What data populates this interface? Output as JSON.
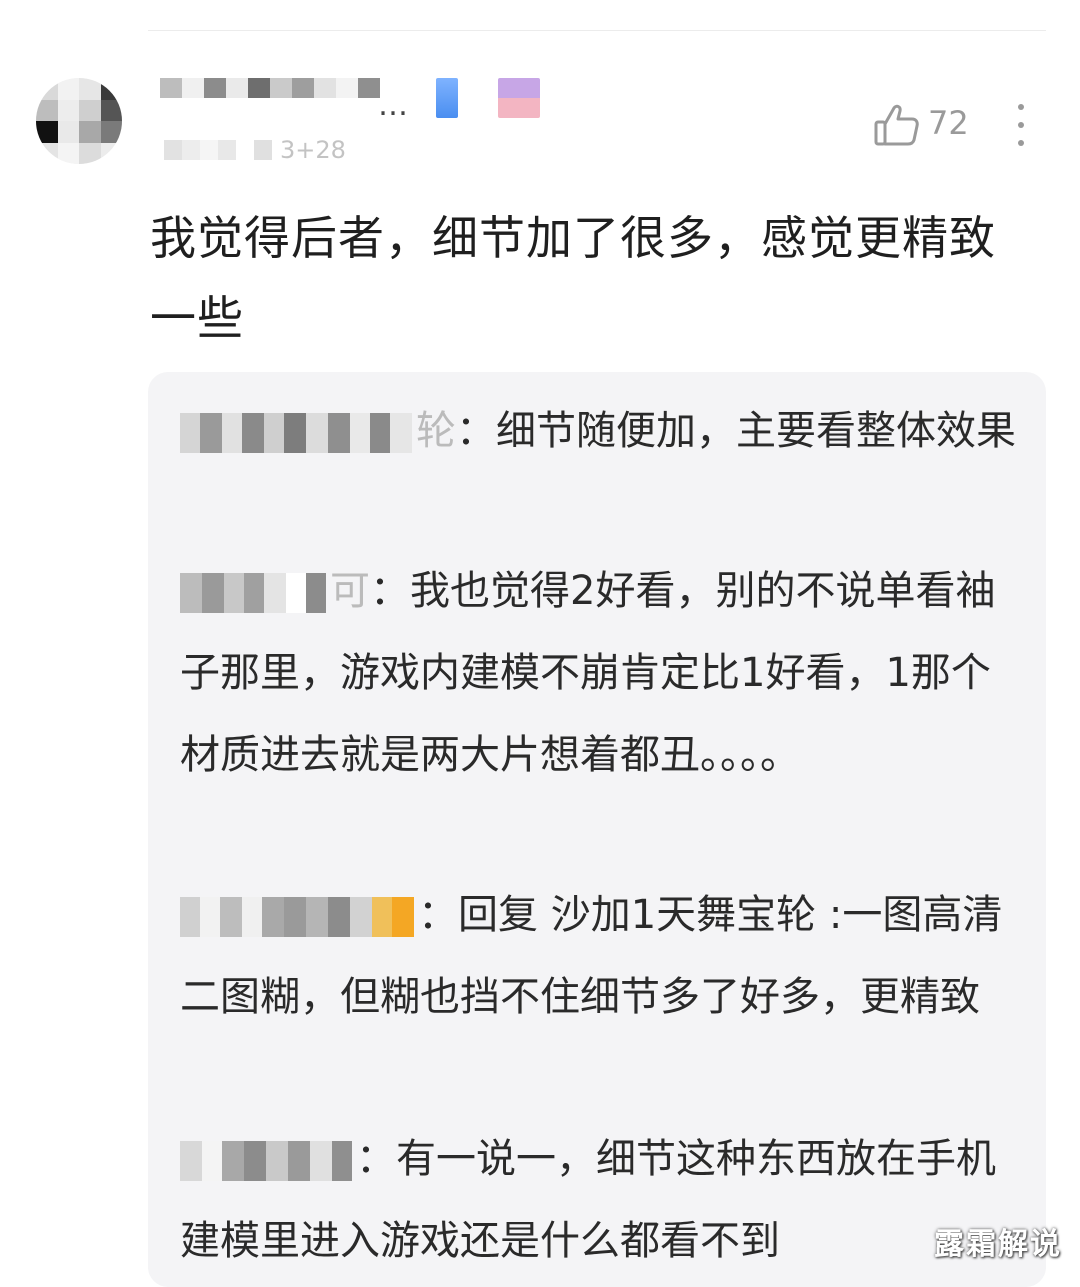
{
  "comment": {
    "like_count": "72",
    "meta_partial": "3+28",
    "username_partial": "…",
    "text": "我觉得后者，细节加了很多，感觉更精致一些"
  },
  "replies": [
    {
      "name_tail": "轮",
      "text": "：细节随便加，主要看整体效果"
    },
    {
      "name_tail": "可",
      "text": "：我也觉得2好看，别的不说单看袖子那里，游戏内建模不崩肯定比1好看，1那个材质进去就是两大片想着都丑。。。。"
    },
    {
      "name_tail": "",
      "text": "：回复 沙加1天舞宝轮 :一图高清二图糊，但糊也挡不住细节多了好多，更精致"
    },
    {
      "name_tail": "",
      "text": "：有一说一，细节这种东西放在手机建模里进入游戏还是什么都看不到"
    }
  ],
  "watermark": "露霜解说",
  "icons": {
    "like": "thumbs-up-icon",
    "more": "more-vertical-icon"
  },
  "colors": {
    "reply_bg": "#f4f4f6",
    "muted": "#9a9a9a"
  }
}
